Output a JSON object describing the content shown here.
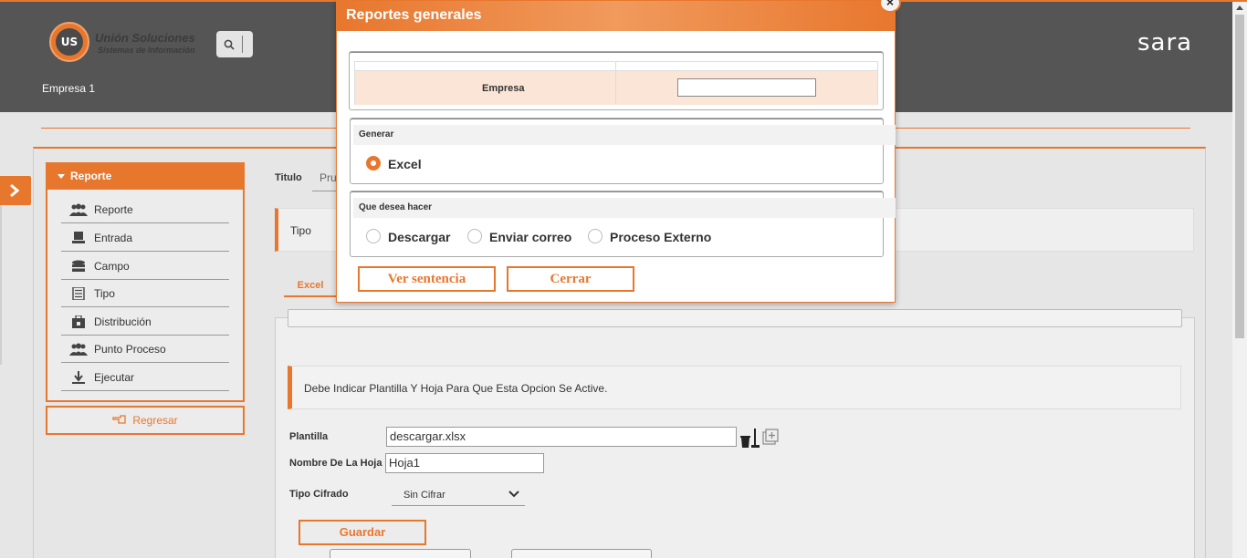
{
  "header": {
    "logo_mark": "UNIÓN US",
    "logo_title": "Unión Soluciones",
    "logo_subtitle": "Sistemas de Información",
    "brand": "sara",
    "company": "Empresa 1"
  },
  "sidebar": {
    "title": "Reporte",
    "items": [
      {
        "label": "Reporte",
        "icon": "users-icon"
      },
      {
        "label": "Entrada",
        "icon": "monitor-icon"
      },
      {
        "label": "Campo",
        "icon": "stack-icon"
      },
      {
        "label": "Tipo",
        "icon": "list-icon"
      },
      {
        "label": "Distribución",
        "icon": "distribution-icon"
      },
      {
        "label": "Punto Proceso",
        "icon": "users-icon"
      },
      {
        "label": "Ejecutar",
        "icon": "download-icon"
      }
    ],
    "back_label": "Regresar"
  },
  "form": {
    "titulo_label": "Titulo",
    "titulo_value": "Pru",
    "tipo_label": "Tipo",
    "tab_label": "Excel",
    "note": "Debe Indicar Plantilla Y Hoja Para Que Esta Opcion Se Active.",
    "plantilla_label": "Plantilla",
    "plantilla_value": "descargar.xlsx",
    "hoja_label": "Nombre De La Hoja",
    "hoja_value": "Hoja1",
    "cifrado_label": "Tipo Cifrado",
    "cifrado_value": "Sin Cifrar",
    "save_label": "Guardar"
  },
  "modal": {
    "title": "Reportes generales",
    "close_label": "×",
    "empresa_label": "Empresa",
    "empresa_value": "",
    "generar_legend": "Generar",
    "generar_options": [
      {
        "label": "Excel",
        "selected": true
      }
    ],
    "accion_legend": "Que desea hacer",
    "accion_options": [
      {
        "label": "Descargar",
        "selected": false
      },
      {
        "label": "Enviar correo",
        "selected": false
      },
      {
        "label": "Proceso Externo",
        "selected": false
      }
    ],
    "ver_label": "Ver sentencia",
    "cerrar_label": "Cerrar"
  },
  "colors": {
    "accent": "#e8772e",
    "header_bg": "#555555",
    "panel_bg": "#e6e6e6"
  }
}
